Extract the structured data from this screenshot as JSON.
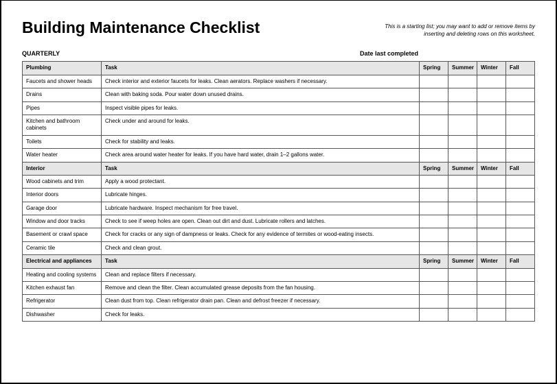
{
  "title": "Building Maintenance Checklist",
  "hint": "This is a starting list; you may want to add or remove items by inserting and deleting rows on this worksheet.",
  "period": "QUARTERLY",
  "date_label": "Date last completed",
  "columns": {
    "task": "Task",
    "spring": "Spring",
    "summer": "Summer",
    "winter": "Winter",
    "fall": "Fall"
  },
  "sections": [
    {
      "category": "Plumbing",
      "rows": [
        {
          "item": "Faucets and shower heads",
          "task": "Check interior and exterior faucets for leaks. Clean aerators. Replace washers if necessary."
        },
        {
          "item": "Drains",
          "task": "Clean with baking soda. Pour water down unused drains."
        },
        {
          "item": "Pipes",
          "task": "Inspect visible pipes for leaks."
        },
        {
          "item": "Kitchen and bathroom cabinets",
          "task": "Check under and around for leaks."
        },
        {
          "item": "Toilets",
          "task": "Check for stability and leaks."
        },
        {
          "item": "Water heater",
          "task": "Check area around water heater for leaks. If you have hard water, drain 1–2 gallons water."
        }
      ]
    },
    {
      "category": "Interior",
      "rows": [
        {
          "item": "Wood cabinets and trim",
          "task": "Apply a wood protectant."
        },
        {
          "item": "Interior doors",
          "task": "Lubricate hinges."
        },
        {
          "item": "Garage door",
          "task": "Lubricate hardware. Inspect mechanism for free travel."
        },
        {
          "item": "Window and door tracks",
          "task": "Check to see if weep holes are open. Clean out dirt and dust. Lubricate rollers and latches."
        },
        {
          "item": "Basement or crawl space",
          "task": "Check for cracks or any sign of dampness or leaks. Check for any evidence of termites or wood-eating insects."
        },
        {
          "item": "Ceramic tile",
          "task": "Check and clean grout."
        }
      ]
    },
    {
      "category": "Electrical and appliances",
      "rows": [
        {
          "item": "Heating and cooling systems",
          "task": "Clean and replace filters if necessary."
        },
        {
          "item": "Kitchen exhaust fan",
          "task": "Remove and clean the filter. Clean accumulated grease deposits from the fan housing."
        },
        {
          "item": "Refrigerator",
          "task": "Clean dust from top. Clean refrigerator drain pan. Clean and defrost freezer if necessary."
        },
        {
          "item": "Dishwasher",
          "task": "Check for leaks."
        }
      ]
    }
  ]
}
